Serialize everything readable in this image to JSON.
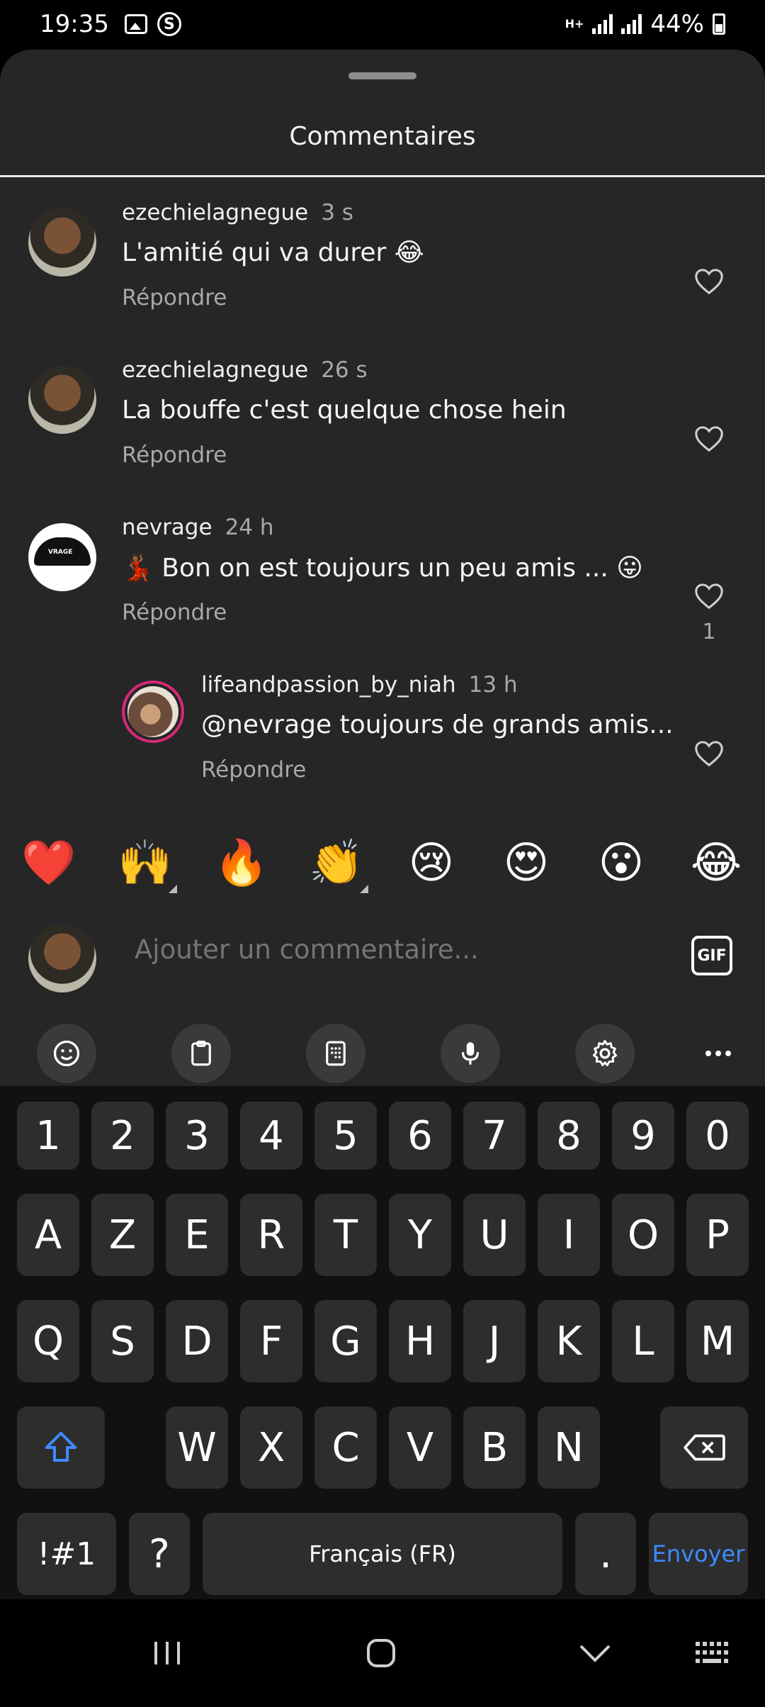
{
  "status_bar": {
    "time": "19:35",
    "network_type": "H+",
    "battery": "44%"
  },
  "sheet": {
    "title": "Commentaires"
  },
  "comments": [
    {
      "user": "ezechielagnegue",
      "time": "3 s",
      "text": "L'amitié qui va durer 😂",
      "reply": "Répondre",
      "likes": ""
    },
    {
      "user": "ezechielagnegue",
      "time": "26 s",
      "text": "La bouffe c'est quelque chose hein",
      "reply": "Répondre",
      "likes": ""
    },
    {
      "user": "nevrage",
      "time": "24 h",
      "text": "💃🏾 Bon on est toujours un peu amis ... 😛",
      "reply": "Répondre",
      "likes": "1"
    },
    {
      "user": "lifeandpassion_by_niah",
      "time": "13 h",
      "text": "@nevrage toujours de grands amis...",
      "reply": "Répondre",
      "likes": ""
    }
  ],
  "reactions": [
    "❤️",
    "🙌",
    "🔥",
    "👏",
    "😢",
    "😍",
    "😮",
    "😂"
  ],
  "input": {
    "placeholder": "Ajouter un commentaire...",
    "gif_label": "GIF"
  },
  "keyboard": {
    "row_numbers": [
      "1",
      "2",
      "3",
      "4",
      "5",
      "6",
      "7",
      "8",
      "9",
      "0"
    ],
    "row_1": [
      "A",
      "Z",
      "E",
      "R",
      "T",
      "Y",
      "U",
      "I",
      "O",
      "P"
    ],
    "row_2": [
      "Q",
      "S",
      "D",
      "F",
      "G",
      "H",
      "J",
      "K",
      "L",
      "M"
    ],
    "row_3": [
      "W",
      "X",
      "C",
      "V",
      "B",
      "N"
    ],
    "symbols_label": "!#1",
    "question_label": "?",
    "space_label": "Français (FR)",
    "period_label": ".",
    "send_label": "Envoyer"
  },
  "colors": {
    "sheet_bg": "#262626",
    "key_bg": "#2d2d2d",
    "accent_blue": "#3d8bff",
    "muted_text": "#a8a8a8"
  }
}
